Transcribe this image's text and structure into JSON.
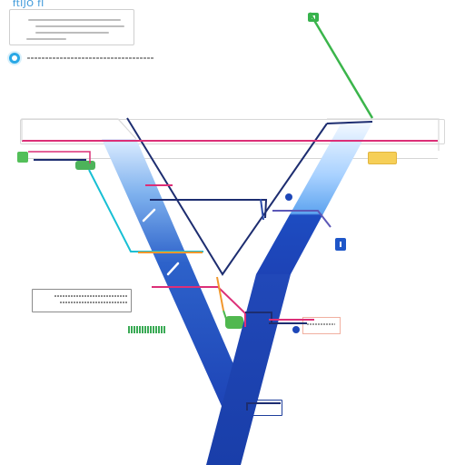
{
  "title": "ftIJO fI",
  "diagram": {
    "colors": {
      "blue": "#1e46b7",
      "light_blue": "#6aa7e6",
      "navy": "#1c2f6c",
      "pink": "#dd2f7f",
      "green": "#4db84f",
      "cyan": "#1ec3d8",
      "orange": "#f1972d",
      "gray": "#d6d6d6"
    },
    "icons": [
      "search-icon",
      "info-icon",
      "node-icon"
    ]
  }
}
